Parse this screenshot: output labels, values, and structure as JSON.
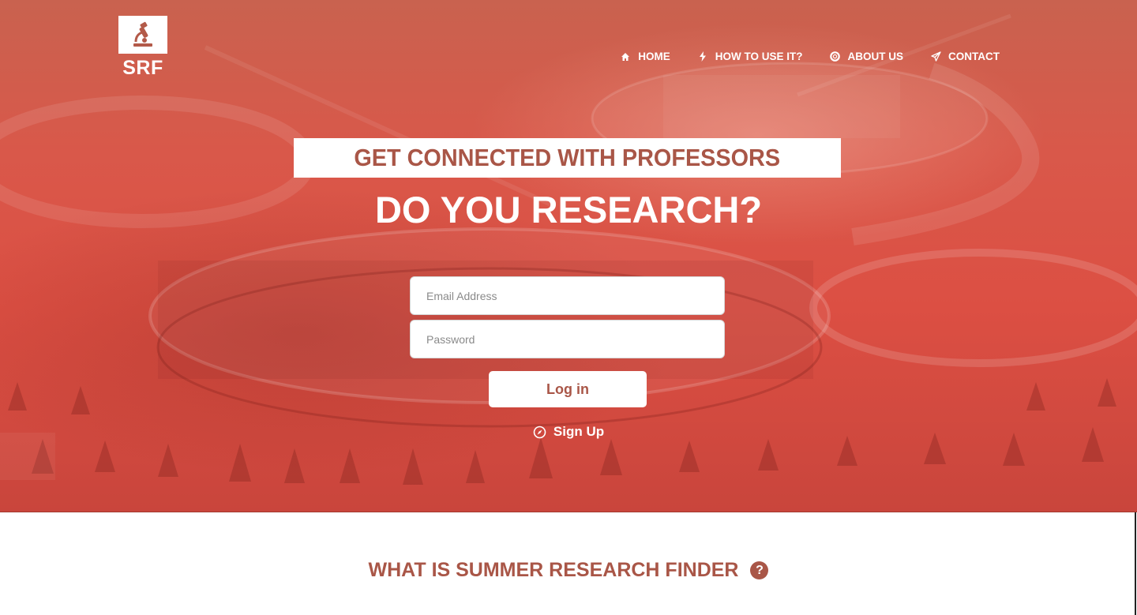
{
  "brand": {
    "name": "SRF",
    "logo_icon": "microscope-icon"
  },
  "nav": {
    "items": [
      {
        "label": "HOME",
        "icon": "home-icon"
      },
      {
        "label": "HOW TO USE IT?",
        "icon": "bolt-icon"
      },
      {
        "label": "ABOUT US",
        "icon": "lifebuoy-icon"
      },
      {
        "label": "CONTACT",
        "icon": "paper-plane-icon"
      }
    ]
  },
  "hero": {
    "banner": "GET CONNECTED WITH PROFESSORS",
    "headline": "DO YOU RESEARCH?"
  },
  "login": {
    "email_placeholder": "Email Address",
    "password_placeholder": "Password",
    "button_label": "Log in",
    "signup_label": "Sign Up",
    "signup_icon": "compass-icon"
  },
  "section": {
    "title": "WHAT IS SUMMER RESEARCH FINDER",
    "help_icon": "question-icon",
    "help_glyph": "?"
  },
  "colors": {
    "hero_overlay": "#dc4f43",
    "accent_text": "#a95647",
    "white": "#ffffff"
  }
}
